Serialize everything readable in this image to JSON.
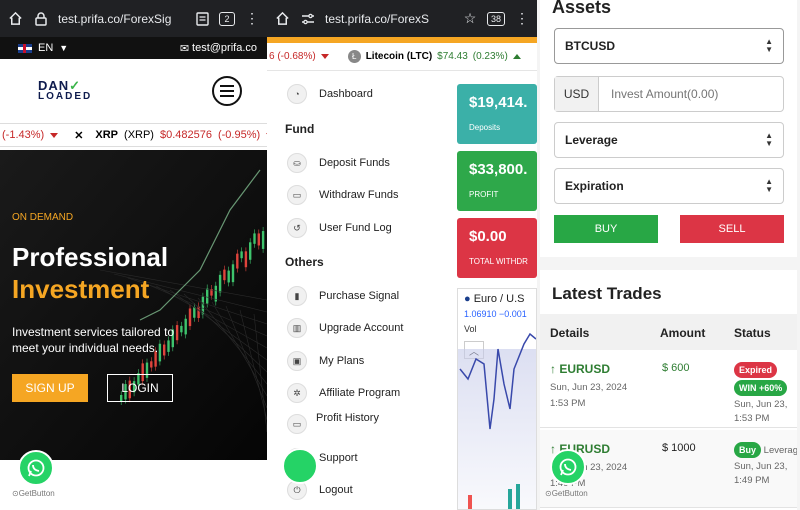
{
  "panel1": {
    "browser": {
      "url": "test.prifa.co/ForexSig",
      "tab_count": "2"
    },
    "topbar": {
      "lang": "EN",
      "email": "test@prifa.co"
    },
    "logo": {
      "line1": "DAN",
      "line2": "LOADED"
    },
    "ticker": {
      "prev_change": "(-1.43%)",
      "symbol": "XRP",
      "symbol_paren": "(XRP)",
      "price": "$0.482576",
      "change": "(-0.95%)"
    },
    "hero": {
      "eyebrow": "ON DEMAND",
      "title_1": "Professional",
      "title_2": "Investment",
      "description": "Investment services tailored to meet your individual needs.",
      "signup": "SIGN UP",
      "login": "LOGIN"
    },
    "getbutton": "GetButton"
  },
  "panel2": {
    "browser": {
      "url": "test.prifa.co/ForexS",
      "tab_count": "38"
    },
    "ticker": {
      "prev_change": "6 (-0.68%)",
      "name": "Litecoin (LTC)",
      "price": "$74.43",
      "change": "(0.23%)"
    },
    "menu": {
      "dashboard": "Dashboard",
      "section_fund": "Fund",
      "deposit": "Deposit Funds",
      "withdraw": "Withdraw Funds",
      "fund_log": "User Fund Log",
      "section_others": "Others",
      "purchase_signal": "Purchase Signal",
      "upgrade": "Upgrade Account",
      "my_plans": "My Plans",
      "affiliate": "Affiliate Program",
      "profit_history": "Profit History",
      "support": "Support",
      "logout": "Logout"
    },
    "cards": [
      {
        "value": "$19,414.",
        "label": "Deposits",
        "color": "#3bb0a8"
      },
      {
        "value": "$33,800.",
        "label": "PROFIT",
        "color": "#2ea84a"
      },
      {
        "value": "$0.00",
        "label": "TOTAL WITHDR",
        "color": "#dc3545"
      }
    ],
    "mini_chart": {
      "title": "Euro / U.S",
      "values": "1.06910  −0.001",
      "vol_label": "Vol"
    }
  },
  "panel3": {
    "assets_title": "Assets",
    "asset_select": "BTCUSD",
    "currency": "USD",
    "amount_placeholder": "Invest Amount(0.00)",
    "leverage_select": "Leverage",
    "expiration_select": "Expiration",
    "buy": "BUY",
    "sell": "SELL",
    "trades_title": "Latest Trades",
    "columns": {
      "details": "Details",
      "amount": "Amount",
      "status": "Status"
    },
    "trades": [
      {
        "pair": "EURUSD",
        "date": "Sun, Jun 23, 2024",
        "time": "1:53 PM",
        "amount": "$ 600",
        "badge1": "Expired",
        "badge2": "WIN +60%",
        "status_date": "Sun, Jun 23,",
        "status_time": "1:53 PM"
      },
      {
        "pair": "EURUSD",
        "date": "Sun, Jun 23, 2024",
        "time": "1:49 PM",
        "amount": "$ 1000",
        "badge1": "Buy",
        "badge1_after": "Leverag",
        "status_date": "Sun, Jun 23,",
        "status_time": "1:49 PM"
      }
    ],
    "getbutton": "GetButton"
  },
  "colors": {
    "accent_orange": "#f5a623",
    "buy_green": "#28a745",
    "sell_red": "#dc3545",
    "whatsapp": "#25d366"
  }
}
